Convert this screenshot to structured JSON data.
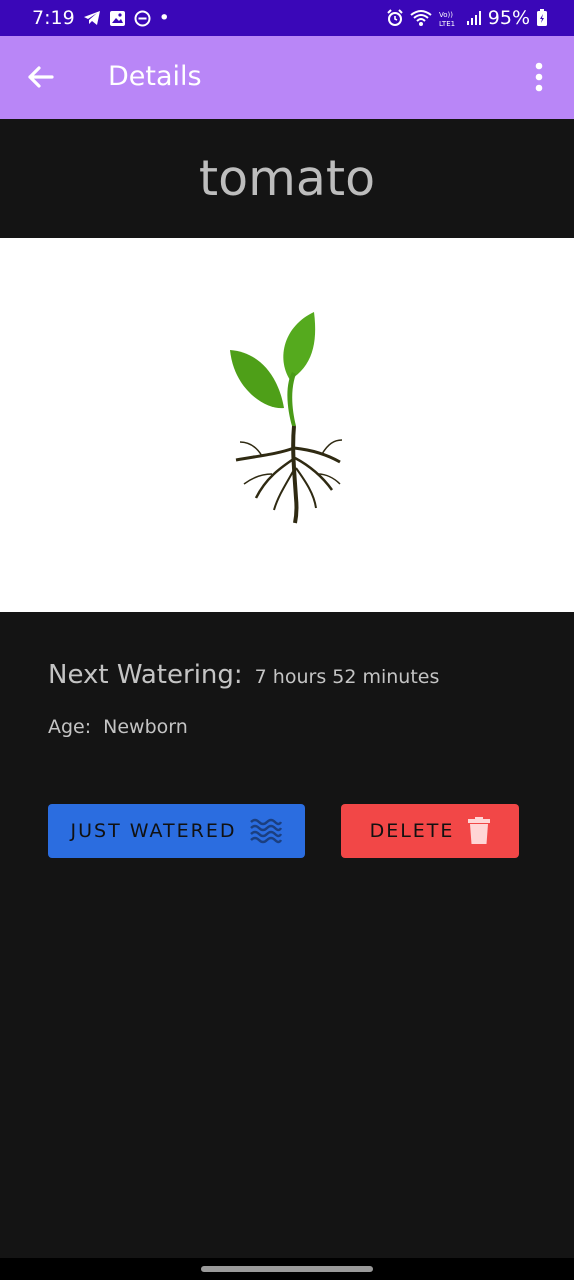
{
  "status_bar": {
    "time": "7:19",
    "battery": "95%",
    "dot": "•",
    "icons": [
      "telegram-icon",
      "gallery-icon",
      "do-not-disturb-icon",
      "alarm-icon",
      "wifi-icon",
      "volte-icon",
      "signal-icon",
      "battery-icon"
    ]
  },
  "app_bar": {
    "title": "Details",
    "back_icon": "arrow-left-icon",
    "menu_icon": "more-vert-icon",
    "background": "#b986f7"
  },
  "plant": {
    "name": "tomato",
    "image": "seedling-with-roots"
  },
  "info": {
    "next_watering_label": "Next Watering:",
    "next_watering_value": "7 hours 52 minutes",
    "age_label": "Age:",
    "age_value": "Newborn"
  },
  "buttons": {
    "watered_label": "JUST WATERED",
    "watered_icon": "water-waves-icon",
    "watered_color": "#2b6de0",
    "delete_label": "DELETE",
    "delete_icon": "trash-icon",
    "delete_color": "#f24747"
  }
}
